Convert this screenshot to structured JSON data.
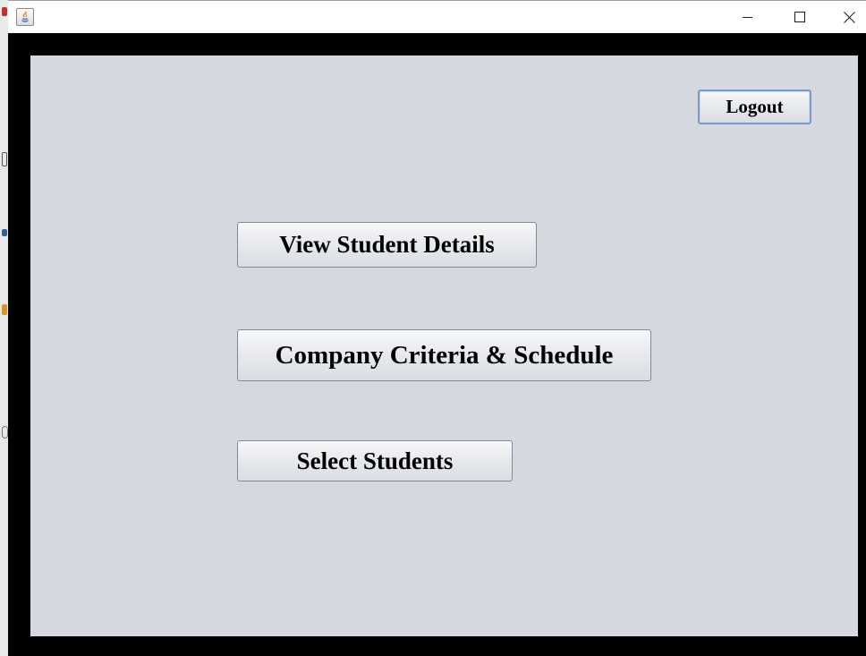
{
  "window": {
    "title": "",
    "controls": {
      "minimize_icon": "minimize-icon",
      "maximize_icon": "maximize-icon",
      "close_icon": "close-icon"
    },
    "app_icon": "java-icon"
  },
  "main": {
    "logout_label": "Logout",
    "view_student_details_label": "View Student Details",
    "company_criteria_label": "Company Criteria & Schedule",
    "select_students_label": "Select Students"
  },
  "colors": {
    "content_background": "#d5d8df",
    "frame_border": "#000000",
    "titlebar": "#ffffff",
    "logout_focus_border": "#7a9cc4"
  }
}
